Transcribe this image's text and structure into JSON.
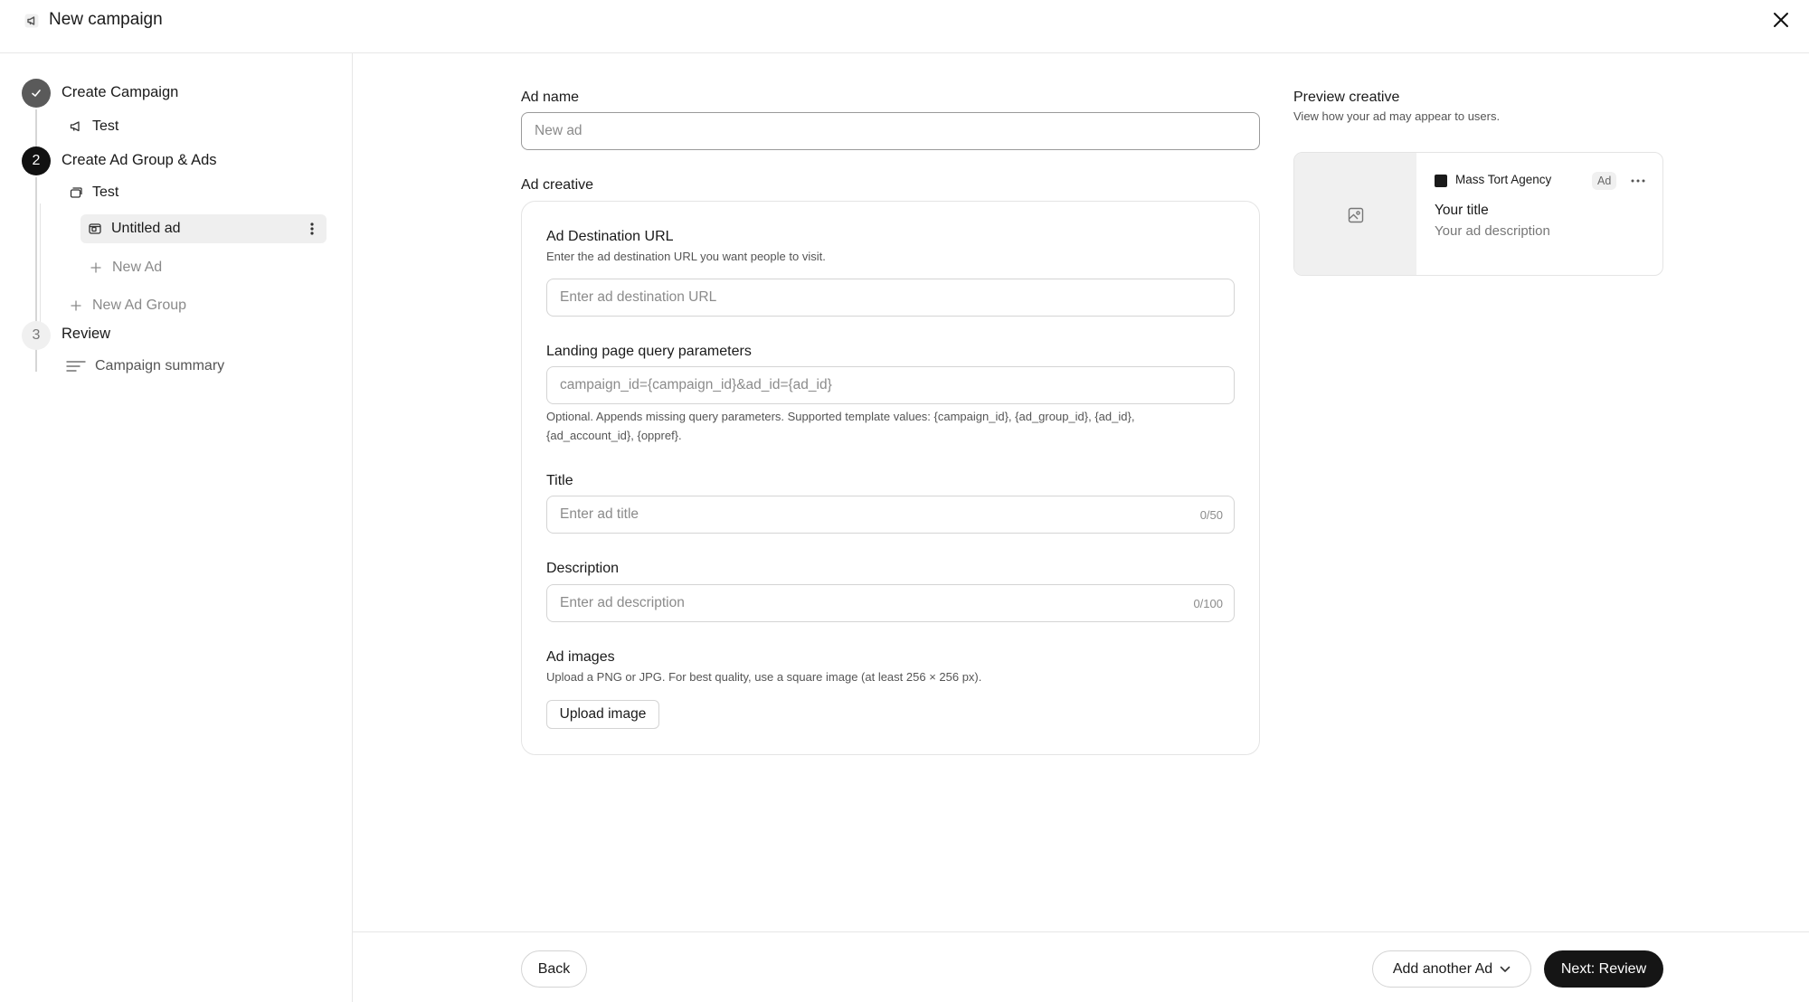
{
  "header": {
    "title": "New campaign",
    "title_icon": "megaphone-icon",
    "close_icon": "close-icon"
  },
  "sidebar": {
    "steps": [
      {
        "number": "1",
        "label": "Create Campaign",
        "status": "completed",
        "icon": "check-icon",
        "children": [
          {
            "label": "Test",
            "icon": "megaphone-icon"
          }
        ]
      },
      {
        "number": "2",
        "label": "Create Ad Group & Ads",
        "status": "active",
        "children": [
          {
            "label": "Test",
            "icon": "layers-icon"
          },
          {
            "label": "Untitled ad",
            "icon": "ad-icon",
            "selected": true
          },
          {
            "label": "New Ad",
            "icon": "plus-icon"
          },
          {
            "label": "New Ad Group",
            "icon": "plus-icon"
          }
        ]
      },
      {
        "number": "3",
        "label": "Review",
        "status": "todo",
        "children": [
          {
            "label": "Campaign summary",
            "icon": "list-icon"
          }
        ]
      }
    ]
  },
  "form": {
    "ad_name": {
      "label": "Ad name",
      "placeholder": "New ad",
      "value": ""
    },
    "ad_creative_label": "Ad creative",
    "destination_url": {
      "label": "Ad Destination URL",
      "help": "Enter the ad destination URL you want people to visit.",
      "placeholder": "Enter ad destination URL"
    },
    "query_params": {
      "label": "Landing page query parameters",
      "placeholder": "campaign_id={campaign_id}&ad_id={ad_id}",
      "help_line1": "Optional. Appends missing query parameters. Supported template values: {campaign_id}, {ad_group_id}, {ad_id},",
      "help_line2": "{ad_account_id}, {oppref}."
    },
    "title": {
      "label": "Title",
      "placeholder": "Enter ad title",
      "counter": "0/50"
    },
    "description": {
      "label": "Description",
      "placeholder": "Enter ad description",
      "counter": "0/100"
    },
    "images": {
      "label": "Ad images",
      "help": "Upload a PNG or JPG. For best quality, use a square image (at least 256 × 256 px).",
      "upload_label": "Upload image"
    }
  },
  "preview": {
    "heading": "Preview creative",
    "subheading": "View how your ad may appear to users.",
    "brand": "Mass Tort Agency",
    "badge": "Ad",
    "title": "Your title",
    "description": "Your ad description",
    "image_icon": "image-placeholder-icon"
  },
  "footer": {
    "back_label": "Back",
    "add_another_label": "Add another Ad",
    "next_label": "Next: Review"
  },
  "colors": {
    "primary_button": "#151515",
    "active_step": "#111111",
    "completed_step": "#5a5a5a",
    "selected_item_bg": "#efefef"
  }
}
